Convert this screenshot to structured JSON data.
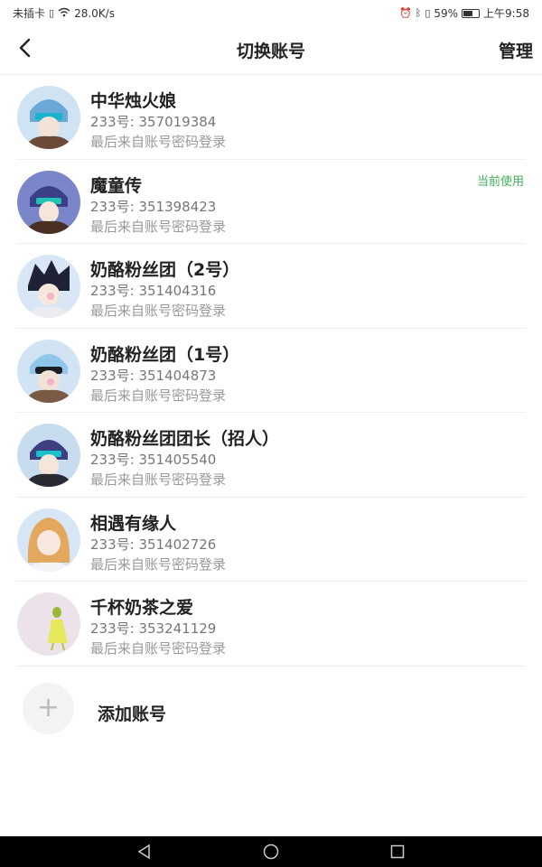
{
  "status_bar": {
    "carrier": "未插卡",
    "speed": "28.0K/s",
    "battery": "59%",
    "time": "上午9:58"
  },
  "header": {
    "title": "切换账号",
    "manage_label": "管理"
  },
  "accounts": [
    {
      "name": "中华烛火娘",
      "uid": "233号: 357019384",
      "login": "最后来自账号密码登录",
      "current": ""
    },
    {
      "name": "魔童传",
      "uid": "233号: 351398423",
      "login": "最后来自账号密码登录",
      "current": "当前使用"
    },
    {
      "name": "奶酪粉丝团（2号）",
      "uid": "233号: 351404316",
      "login": "最后来自账号密码登录",
      "current": ""
    },
    {
      "name": "奶酪粉丝团（1号）",
      "uid": "233号: 351404873",
      "login": "最后来自账号密码登录",
      "current": ""
    },
    {
      "name": "奶酪粉丝团团长（招人）",
      "uid": "233号: 351405540",
      "login": "最后来自账号密码登录",
      "current": ""
    },
    {
      "name": "相遇有缘人",
      "uid": "233号: 351402726",
      "login": "最后来自账号密码登录",
      "current": ""
    },
    {
      "name": "千杯奶茶之爱",
      "uid": "233号: 353241129",
      "login": "最后来自账号密码登录",
      "current": ""
    }
  ],
  "add_account": {
    "icon": "+",
    "label": "添加账号"
  },
  "colors": {
    "current_badge": "#3fae5a",
    "divider": "#eeeeee"
  }
}
